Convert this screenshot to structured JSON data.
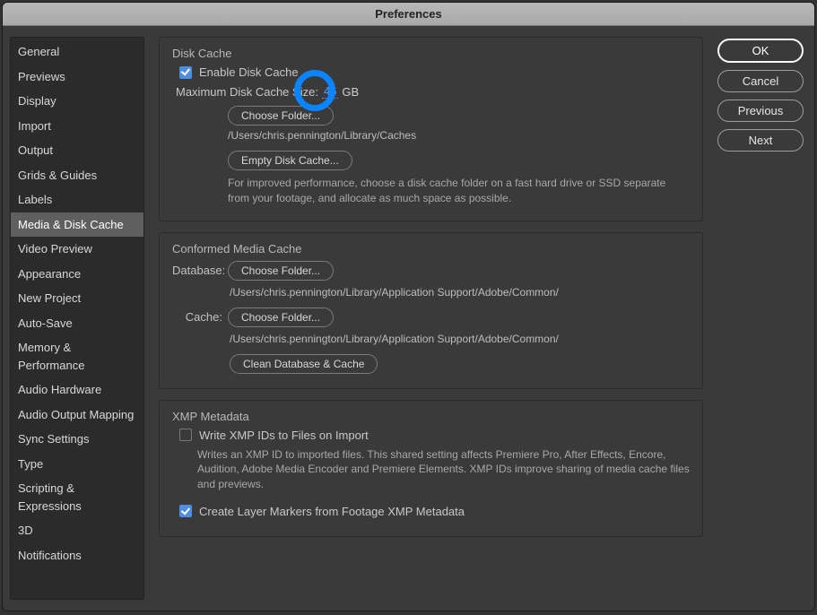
{
  "title": "Preferences",
  "sidebar": {
    "items": [
      {
        "label": "General"
      },
      {
        "label": "Previews"
      },
      {
        "label": "Display"
      },
      {
        "label": "Import"
      },
      {
        "label": "Output"
      },
      {
        "label": "Grids & Guides"
      },
      {
        "label": "Labels"
      },
      {
        "label": "Media & Disk Cache",
        "active": true
      },
      {
        "label": "Video Preview"
      },
      {
        "label": "Appearance"
      },
      {
        "label": "New Project"
      },
      {
        "label": "Auto-Save"
      },
      {
        "label": "Memory & Performance"
      },
      {
        "label": "Audio Hardware"
      },
      {
        "label": "Audio Output Mapping"
      },
      {
        "label": "Sync Settings"
      },
      {
        "label": "Type"
      },
      {
        "label": "Scripting & Expressions"
      },
      {
        "label": "3D"
      },
      {
        "label": "Notifications"
      }
    ]
  },
  "diskCache": {
    "title": "Disk Cache",
    "enableLabel": "Enable Disk Cache",
    "enableChecked": true,
    "maxLabel": "Maximum Disk Cache Size:",
    "maxValue": "46",
    "maxUnit": "GB",
    "chooseFolder": "Choose Folder...",
    "path": "/Users/chris.pennington/Library/Caches",
    "emptyBtn": "Empty Disk Cache...",
    "hint": "For improved performance, choose a disk cache folder on a fast hard drive or SSD separate from your footage, and allocate as much space as possible."
  },
  "conformed": {
    "title": "Conformed Media Cache",
    "dbLabel": "Database:",
    "dbChoose": "Choose Folder...",
    "dbPath": "/Users/chris.pennington/Library/Application Support/Adobe/Common/",
    "cacheLabel": "Cache:",
    "cacheChoose": "Choose Folder...",
    "cachePath": "/Users/chris.pennington/Library/Application Support/Adobe/Common/",
    "cleanBtn": "Clean Database & Cache"
  },
  "xmp": {
    "title": "XMP Metadata",
    "writeLabel": "Write XMP IDs to Files on Import",
    "writeChecked": false,
    "writeHint": "Writes an XMP ID to imported files. This shared setting affects Premiere Pro, After Effects, Encore, Audition, Adobe Media Encoder and Premiere Elements. XMP IDs improve sharing of media cache files and previews.",
    "markersLabel": "Create Layer Markers from Footage XMP Metadata",
    "markersChecked": true
  },
  "buttons": {
    "ok": "OK",
    "cancel": "Cancel",
    "previous": "Previous",
    "next": "Next"
  }
}
